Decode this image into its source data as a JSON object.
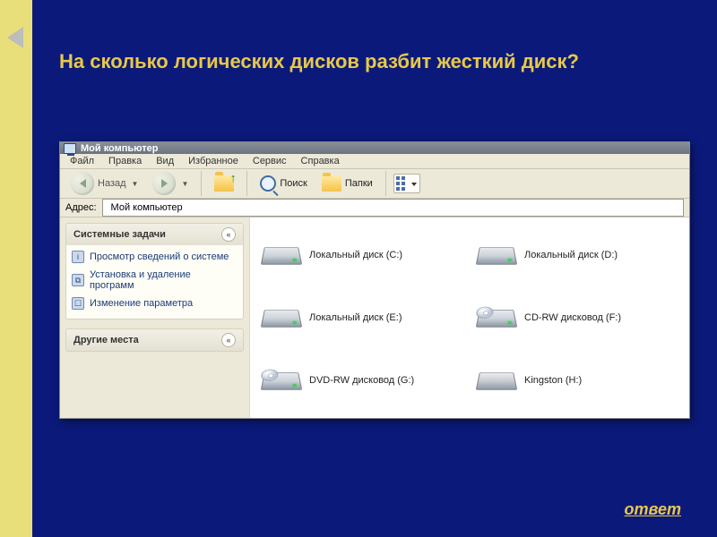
{
  "slide": {
    "question": "На сколько логических дисков разбит жесткий диск?",
    "answer_label": "ответ"
  },
  "window": {
    "title": "Мой компьютер"
  },
  "menu": {
    "file": "Файл",
    "edit": "Правка",
    "view": "Вид",
    "favorites": "Избранное",
    "tools": "Сервис",
    "help": "Справка"
  },
  "toolbar": {
    "back": "Назад",
    "search": "Поиск",
    "folders": "Папки"
  },
  "address": {
    "label": "Адрес:",
    "value": "Мой компьютер"
  },
  "sidebar": {
    "system_tasks": {
      "title": "Системные задачи",
      "items": [
        "Просмотр сведений о системе",
        "Установка и удаление программ",
        "Изменение параметра"
      ]
    },
    "other_places": {
      "title": "Другие места"
    }
  },
  "drives": [
    {
      "label": "Локальный диск (C:)",
      "type": "hdd"
    },
    {
      "label": "Локальный диск (D:)",
      "type": "hdd"
    },
    {
      "label": "Локальный диск (E:)",
      "type": "hdd"
    },
    {
      "label": "CD-RW дисковод (F:)",
      "type": "cd"
    },
    {
      "label": "DVD-RW дисковод (G:)",
      "type": "cd"
    },
    {
      "label": "Kingston (H:)",
      "type": "usb"
    }
  ]
}
